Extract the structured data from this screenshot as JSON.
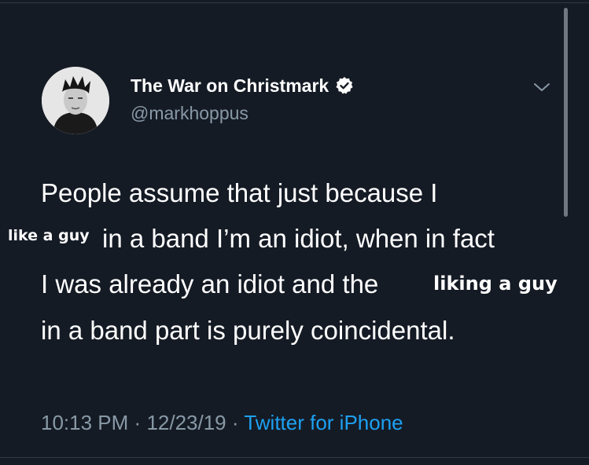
{
  "tweet": {
    "display_name": "The War on Christmark",
    "handle": "@markhoppus",
    "lines": [
      "People assume that just because I",
      "in a band I’m an idiot, when in fact",
      "I was already an idiot and the",
      "in a band part is purely coincidental."
    ],
    "overlay_1": "like a guy",
    "overlay_2": "liking a guy",
    "time": "10:13 PM",
    "dot": "·",
    "date": "12/23/19",
    "source": "Twitter for iPhone"
  },
  "colors": {
    "background": "#151b25",
    "text": "#ffffff",
    "muted": "#8899a6",
    "link": "#1da1f2"
  },
  "icons": {
    "verified": "verified-badge-icon",
    "menu": "chevron-down-icon"
  }
}
